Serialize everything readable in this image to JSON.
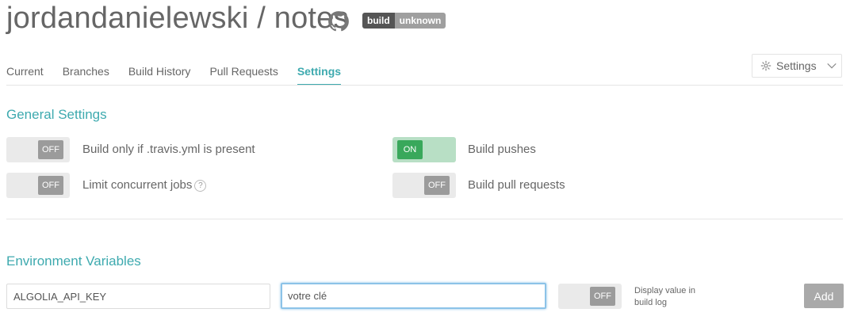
{
  "header": {
    "repo_title": "jordandanielewski / notes",
    "github_icon": "github-icon",
    "badge": {
      "left": "build",
      "right": "unknown"
    }
  },
  "tabs": [
    {
      "label": "Current",
      "active": false
    },
    {
      "label": "Branches",
      "active": false
    },
    {
      "label": "Build History",
      "active": false
    },
    {
      "label": "Pull Requests",
      "active": false
    },
    {
      "label": "Settings",
      "active": true
    }
  ],
  "settings_menu": {
    "label": "Settings",
    "icon": "gear-icon",
    "chevron": "chevron-down-icon"
  },
  "general_settings": {
    "title": "General Settings",
    "options": [
      {
        "label": "Build only if .travis.yml is present",
        "state": "OFF"
      },
      {
        "label": "Build pushes",
        "state": "ON"
      },
      {
        "label": "Limit concurrent jobs",
        "state": "OFF",
        "help": "?"
      },
      {
        "label": "Build pull requests",
        "state": "OFF"
      }
    ]
  },
  "env_vars": {
    "title": "Environment Variables",
    "name_value": "ALGOLIA_API_KEY",
    "value_value": "votre clé",
    "display_toggle": "OFF",
    "display_label": "Display value in build log",
    "add_label": "Add"
  },
  "colors": {
    "accent": "#3eaaaf",
    "toggle_on": "#39a85b",
    "toggle_off": "#9b9b9b"
  }
}
